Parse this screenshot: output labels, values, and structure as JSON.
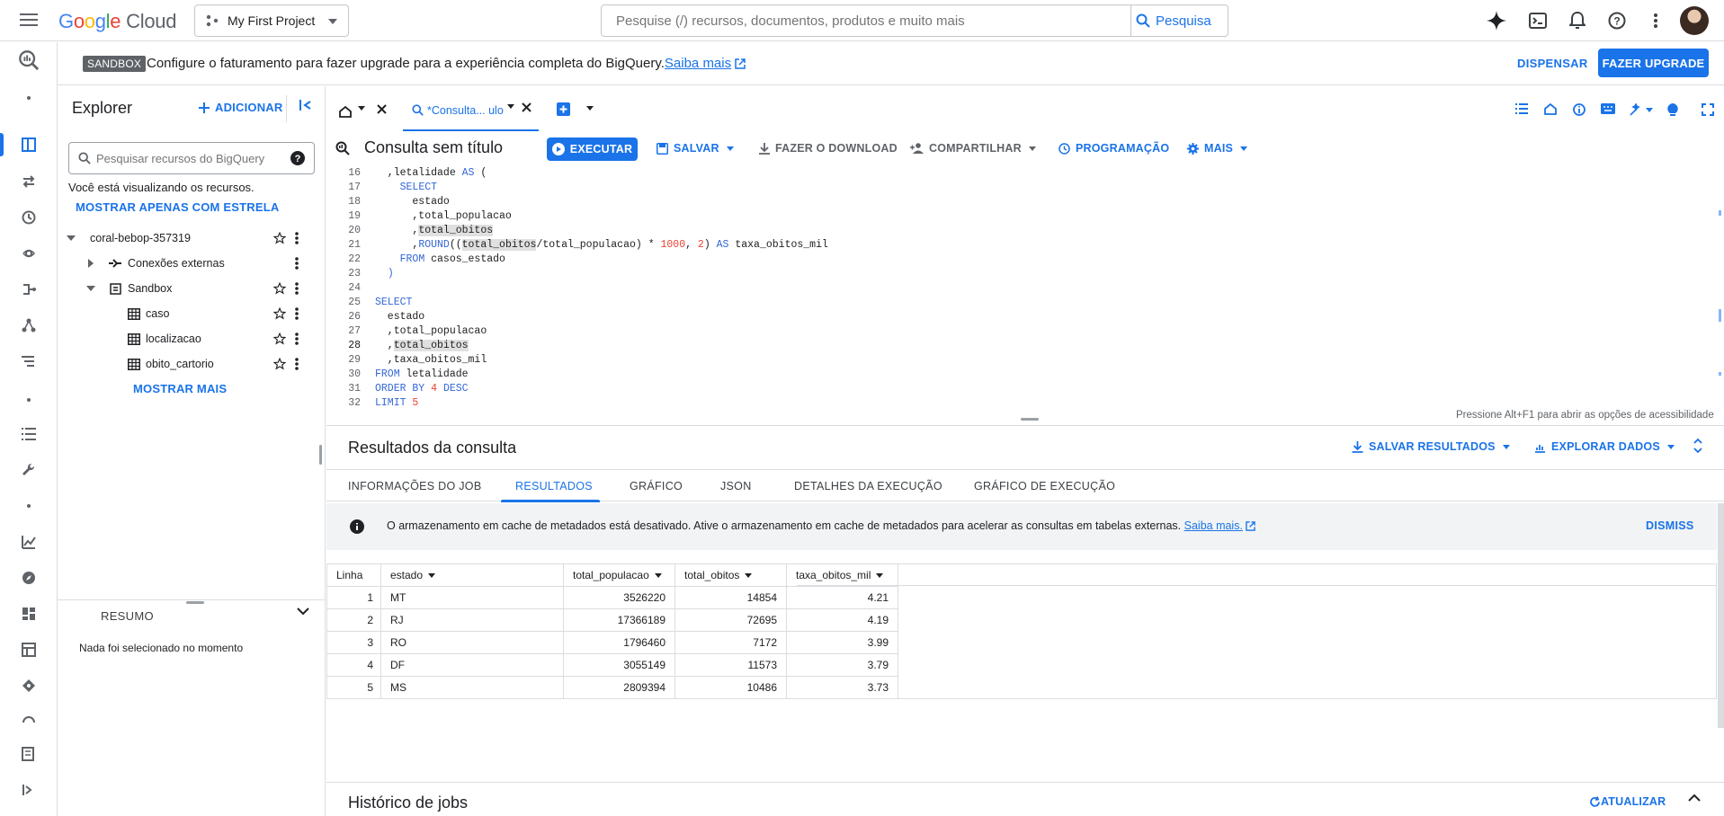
{
  "topbar": {
    "logo_google": [
      "G",
      "o",
      "o",
      "g",
      "l",
      "e"
    ],
    "logo_cloud": "Cloud",
    "project": "My First Project",
    "search_placeholder": "Pesquise (/) recursos, documentos, produtos e muito mais",
    "search_button": "Pesquisa"
  },
  "banner": {
    "tag": "SANDBOX",
    "text": "Configure o faturamento para fazer upgrade para a experiência completa do BigQuery.",
    "link": "Saiba mais",
    "dismiss": "DISPENSAR",
    "upgrade": "FAZER UPGRADE"
  },
  "explorer": {
    "title": "Explorer",
    "add": "ADICIONAR",
    "search_placeholder": "Pesquisar recursos do BigQuery",
    "info": "Você está visualizando os recursos.",
    "starred_only": "MOSTRAR APENAS COM ESTRELA",
    "project": "coral-bebop-357319",
    "external": "Conexões externas",
    "dataset": "Sandbox",
    "tables": [
      "caso",
      "localizacao",
      "obito_cartorio"
    ],
    "more": "MOSTRAR MAIS",
    "summary": "RESUMO",
    "summary_empty": "Nada foi selecionado no momento"
  },
  "tabs": {
    "query_tab": "*Consulta... ulo"
  },
  "query": {
    "title": "Consulta sem título",
    "run": "EXECUTAR",
    "save": "SALVAR",
    "download": "FAZER O DOWNLOAD",
    "share": "COMPARTILHAR",
    "schedule": "PROGRAMAÇÃO",
    "more": "MAIS"
  },
  "editor": {
    "a11y_hint": "Pressione Alt+F1 para abrir as opções de acessibilidade",
    "line_numbers": [
      "16",
      "17",
      "18",
      "19",
      "20",
      "21",
      "22",
      "23",
      "24",
      "25",
      "26",
      "27",
      "28",
      "29",
      "30",
      "31",
      "32"
    ]
  },
  "results": {
    "title": "Resultados da consulta",
    "save_results": "SALVAR RESULTADOS",
    "explore": "EXPLORAR DADOS",
    "tabs": [
      "INFORMAÇÕES DO JOB",
      "RESULTADOS",
      "GRÁFICO",
      "JSON",
      "DETALHES DA EXECUÇÃO",
      "GRÁFICO DE EXECUÇÃO"
    ],
    "cache_text": "O armazenamento em cache de metadados está desativado. Ative o armazenamento em cache de metadados para acelerar as consultas em tabelas externas.",
    "cache_link": "Saiba mais.",
    "cache_dismiss": "DISMISS",
    "columns": [
      "Linha",
      "estado",
      "total_populacao",
      "total_obitos",
      "taxa_obitos_mil"
    ],
    "rows": [
      [
        "1",
        "MT",
        "3526220",
        "14854",
        "4.21"
      ],
      [
        "2",
        "RJ",
        "17366189",
        "72695",
        "4.19"
      ],
      [
        "3",
        "RO",
        "1796460",
        "7172",
        "3.99"
      ],
      [
        "4",
        "DF",
        "3055149",
        "11573",
        "3.79"
      ],
      [
        "5",
        "MS",
        "2809394",
        "10486",
        "3.73"
      ]
    ]
  },
  "jobs": {
    "title": "Histórico de jobs",
    "refresh": "ATUALIZAR"
  }
}
